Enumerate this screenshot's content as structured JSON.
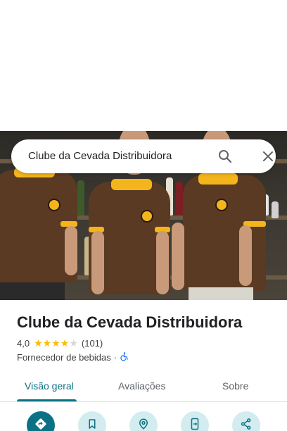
{
  "search": {
    "query": "Clube da Cevada Distribuidora"
  },
  "place": {
    "name": "Clube da Cevada Distribuidora",
    "rating": "4,0",
    "rating_value": 4,
    "rating_max": 5,
    "review_count": "(101)",
    "category": "Fornecedor de bebidas",
    "separator": "·"
  },
  "tabs": [
    {
      "label": "Visão geral",
      "active": true
    },
    {
      "label": "Avaliações",
      "active": false
    },
    {
      "label": "Sobre",
      "active": false
    }
  ],
  "colors": {
    "accent": "#0b7285",
    "accent_light": "#d2ecf0",
    "star": "#fbbc04",
    "shirt": "#5a3a22",
    "collar": "#f3b51b"
  },
  "icons": {
    "search": "search-icon",
    "close": "close-icon",
    "accessibility": "wheelchair-icon",
    "directions": "directions-icon",
    "save": "bookmark-icon",
    "nearby": "nearby-icon",
    "send": "send-to-phone-icon",
    "share": "share-icon"
  }
}
